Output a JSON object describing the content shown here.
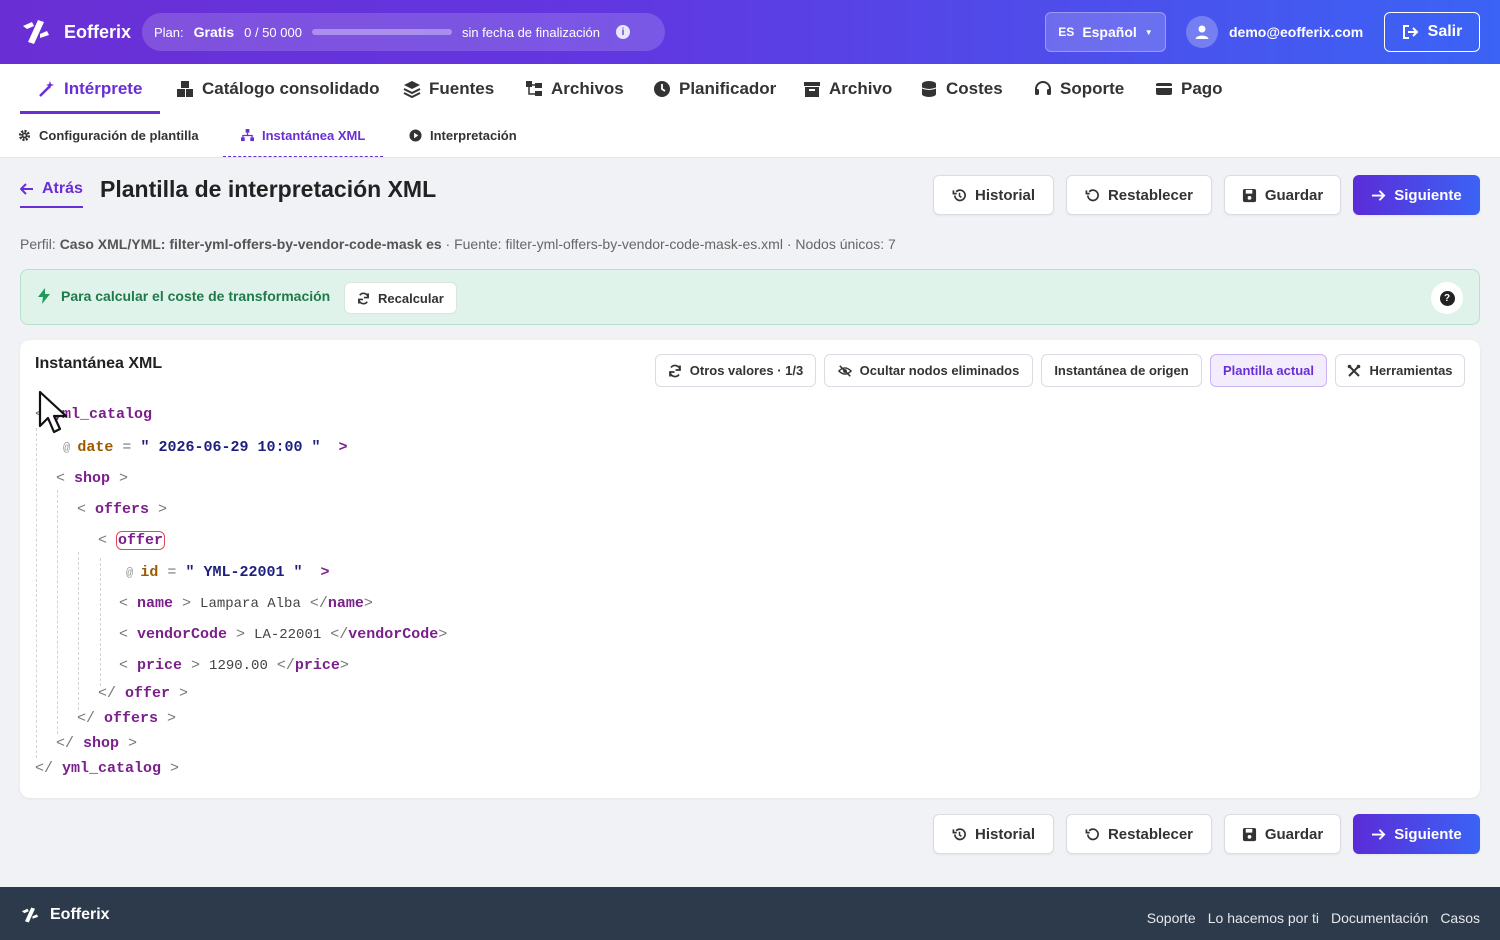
{
  "header": {
    "brand": "Eofferix",
    "plan": {
      "label": "Plan:",
      "name": "Gratis",
      "usage": "0 / 50 000",
      "usage_fraction": 0,
      "expiry": "sin fecha de finalización"
    },
    "language": {
      "code": "ES",
      "label": "Español"
    },
    "user_email": "demo@eofferix.com",
    "logout_label": "Salir"
  },
  "main_nav": [
    {
      "label": "Intérprete",
      "icon": "magic-wand-icon",
      "active": true
    },
    {
      "label": "Catálogo consolidado",
      "icon": "boxes-icon"
    },
    {
      "label": "Fuentes",
      "icon": "layers-icon"
    },
    {
      "label": "Archivos",
      "icon": "folder-tree-icon"
    },
    {
      "label": "Planificador",
      "icon": "clock-icon"
    },
    {
      "label": "Archivo",
      "icon": "archive-box-icon"
    },
    {
      "label": "Costes",
      "icon": "coins-icon"
    },
    {
      "label": "Soporte",
      "icon": "headset-icon"
    },
    {
      "label": "Pago",
      "icon": "credit-card-icon"
    }
  ],
  "sub_nav": [
    {
      "label": "Configuración de plantilla",
      "icon": "gear-icon"
    },
    {
      "label": "Instantánea XML",
      "icon": "sitemap-icon",
      "active": true
    },
    {
      "label": "Interpretación",
      "icon": "play-circle-icon"
    }
  ],
  "page": {
    "back_label": "Atrás",
    "title": "Plantilla de interpretación XML",
    "actions": {
      "history": "Historial",
      "reset": "Restablecer",
      "save": "Guardar",
      "next": "Siguiente"
    },
    "meta": {
      "profile_label": "Perfil:",
      "profile_value": "Caso XML/YML: filter-yml-offers-by-vendor-code-mask es",
      "rest": "· Fuente: filter-yml-offers-by-vendor-code-mask-es.xml · Nodos únicos: 7"
    }
  },
  "banner": {
    "text": "Para calcular el coste de transformación",
    "recalc_label": "Recalcular",
    "help_glyph": "?"
  },
  "snapshot": {
    "title": "Instantánea XML",
    "toolbar": {
      "other_values": "Otros valores · 1/3",
      "hide_removed": "Ocultar nodos eliminados",
      "source_snapshot": "Instantánea de origen",
      "current_template": "Plantilla actual",
      "tools": "Herramientas"
    },
    "xml": {
      "root_tag": "yml_catalog",
      "root_attr_name": "date",
      "root_attr_value": "2026-06-29 10:00",
      "shop_tag": "shop",
      "offers_tag": "offers",
      "offer_tag": "offer",
      "offer_attr_name": "id",
      "offer_attr_value": "YML-22001",
      "fields": [
        {
          "tag": "name",
          "value": "Lampara Alba"
        },
        {
          "tag": "vendorCode",
          "value": "LA-22001"
        },
        {
          "tag": "price",
          "value": "1290.00"
        }
      ]
    }
  },
  "footer": {
    "brand": "Eofferix",
    "links": [
      "Soporte",
      "Lo hacemos por ti",
      "Documentación",
      "Casos"
    ]
  }
}
